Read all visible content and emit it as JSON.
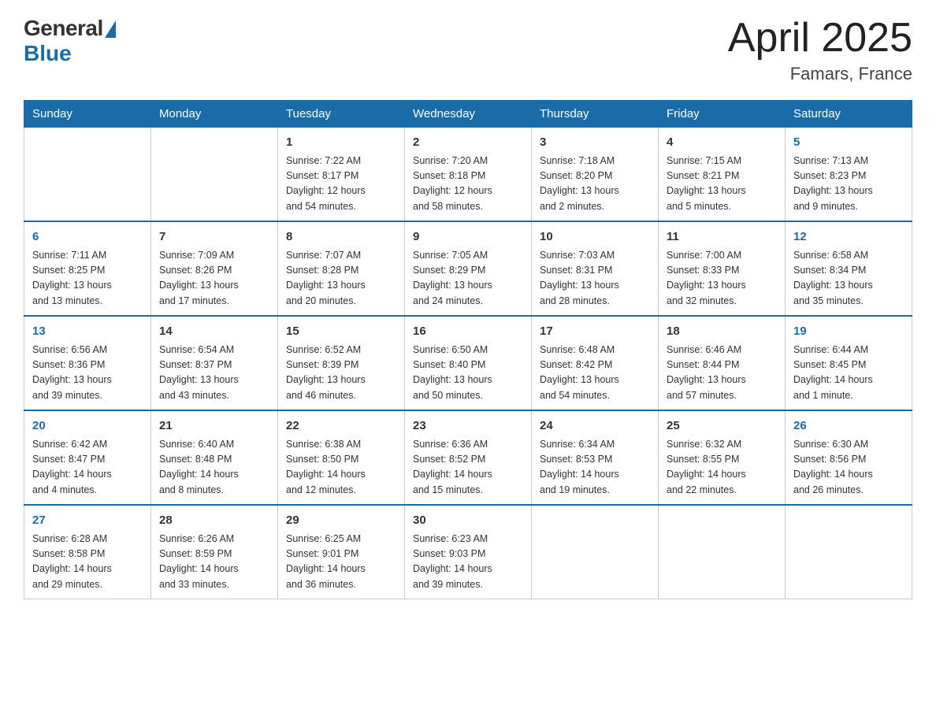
{
  "header": {
    "logo_general": "General",
    "logo_blue": "Blue",
    "title": "April 2025",
    "location": "Famars, France"
  },
  "days_of_week": [
    "Sunday",
    "Monday",
    "Tuesday",
    "Wednesday",
    "Thursday",
    "Friday",
    "Saturday"
  ],
  "weeks": [
    {
      "days": [
        {
          "date": "",
          "info": ""
        },
        {
          "date": "",
          "info": ""
        },
        {
          "date": "1",
          "info": "Sunrise: 7:22 AM\nSunset: 8:17 PM\nDaylight: 12 hours\nand 54 minutes."
        },
        {
          "date": "2",
          "info": "Sunrise: 7:20 AM\nSunset: 8:18 PM\nDaylight: 12 hours\nand 58 minutes."
        },
        {
          "date": "3",
          "info": "Sunrise: 7:18 AM\nSunset: 8:20 PM\nDaylight: 13 hours\nand 2 minutes."
        },
        {
          "date": "4",
          "info": "Sunrise: 7:15 AM\nSunset: 8:21 PM\nDaylight: 13 hours\nand 5 minutes."
        },
        {
          "date": "5",
          "info": "Sunrise: 7:13 AM\nSunset: 8:23 PM\nDaylight: 13 hours\nand 9 minutes."
        }
      ]
    },
    {
      "days": [
        {
          "date": "6",
          "info": "Sunrise: 7:11 AM\nSunset: 8:25 PM\nDaylight: 13 hours\nand 13 minutes."
        },
        {
          "date": "7",
          "info": "Sunrise: 7:09 AM\nSunset: 8:26 PM\nDaylight: 13 hours\nand 17 minutes."
        },
        {
          "date": "8",
          "info": "Sunrise: 7:07 AM\nSunset: 8:28 PM\nDaylight: 13 hours\nand 20 minutes."
        },
        {
          "date": "9",
          "info": "Sunrise: 7:05 AM\nSunset: 8:29 PM\nDaylight: 13 hours\nand 24 minutes."
        },
        {
          "date": "10",
          "info": "Sunrise: 7:03 AM\nSunset: 8:31 PM\nDaylight: 13 hours\nand 28 minutes."
        },
        {
          "date": "11",
          "info": "Sunrise: 7:00 AM\nSunset: 8:33 PM\nDaylight: 13 hours\nand 32 minutes."
        },
        {
          "date": "12",
          "info": "Sunrise: 6:58 AM\nSunset: 8:34 PM\nDaylight: 13 hours\nand 35 minutes."
        }
      ]
    },
    {
      "days": [
        {
          "date": "13",
          "info": "Sunrise: 6:56 AM\nSunset: 8:36 PM\nDaylight: 13 hours\nand 39 minutes."
        },
        {
          "date": "14",
          "info": "Sunrise: 6:54 AM\nSunset: 8:37 PM\nDaylight: 13 hours\nand 43 minutes."
        },
        {
          "date": "15",
          "info": "Sunrise: 6:52 AM\nSunset: 8:39 PM\nDaylight: 13 hours\nand 46 minutes."
        },
        {
          "date": "16",
          "info": "Sunrise: 6:50 AM\nSunset: 8:40 PM\nDaylight: 13 hours\nand 50 minutes."
        },
        {
          "date": "17",
          "info": "Sunrise: 6:48 AM\nSunset: 8:42 PM\nDaylight: 13 hours\nand 54 minutes."
        },
        {
          "date": "18",
          "info": "Sunrise: 6:46 AM\nSunset: 8:44 PM\nDaylight: 13 hours\nand 57 minutes."
        },
        {
          "date": "19",
          "info": "Sunrise: 6:44 AM\nSunset: 8:45 PM\nDaylight: 14 hours\nand 1 minute."
        }
      ]
    },
    {
      "days": [
        {
          "date": "20",
          "info": "Sunrise: 6:42 AM\nSunset: 8:47 PM\nDaylight: 14 hours\nand 4 minutes."
        },
        {
          "date": "21",
          "info": "Sunrise: 6:40 AM\nSunset: 8:48 PM\nDaylight: 14 hours\nand 8 minutes."
        },
        {
          "date": "22",
          "info": "Sunrise: 6:38 AM\nSunset: 8:50 PM\nDaylight: 14 hours\nand 12 minutes."
        },
        {
          "date": "23",
          "info": "Sunrise: 6:36 AM\nSunset: 8:52 PM\nDaylight: 14 hours\nand 15 minutes."
        },
        {
          "date": "24",
          "info": "Sunrise: 6:34 AM\nSunset: 8:53 PM\nDaylight: 14 hours\nand 19 minutes."
        },
        {
          "date": "25",
          "info": "Sunrise: 6:32 AM\nSunset: 8:55 PM\nDaylight: 14 hours\nand 22 minutes."
        },
        {
          "date": "26",
          "info": "Sunrise: 6:30 AM\nSunset: 8:56 PM\nDaylight: 14 hours\nand 26 minutes."
        }
      ]
    },
    {
      "days": [
        {
          "date": "27",
          "info": "Sunrise: 6:28 AM\nSunset: 8:58 PM\nDaylight: 14 hours\nand 29 minutes."
        },
        {
          "date": "28",
          "info": "Sunrise: 6:26 AM\nSunset: 8:59 PM\nDaylight: 14 hours\nand 33 minutes."
        },
        {
          "date": "29",
          "info": "Sunrise: 6:25 AM\nSunset: 9:01 PM\nDaylight: 14 hours\nand 36 minutes."
        },
        {
          "date": "30",
          "info": "Sunrise: 6:23 AM\nSunset: 9:03 PM\nDaylight: 14 hours\nand 39 minutes."
        },
        {
          "date": "",
          "info": ""
        },
        {
          "date": "",
          "info": ""
        },
        {
          "date": "",
          "info": ""
        }
      ]
    }
  ]
}
